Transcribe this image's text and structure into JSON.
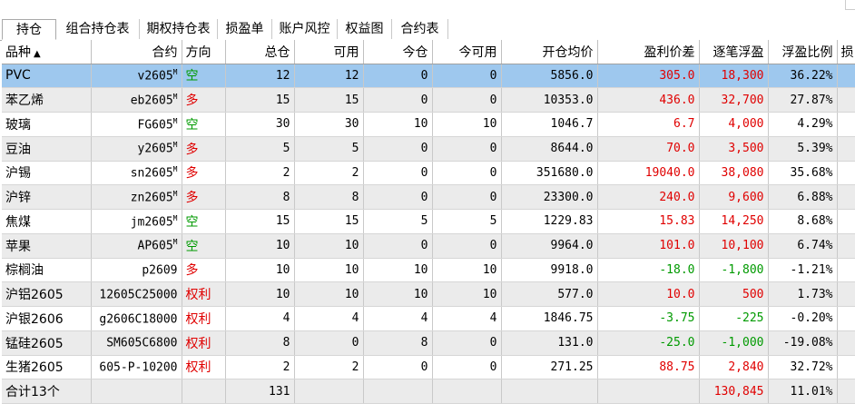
{
  "tabs": [
    "持仓",
    "组合持仓表",
    "期权持仓表",
    "损盈单",
    "账户风控",
    "权益图",
    "合约表"
  ],
  "active_tab": 0,
  "colors": {
    "selected_row": "#9ec8ee",
    "stripe": "#ebebeb",
    "up": "#e00000",
    "down": "#009a00"
  },
  "columns": [
    "品种",
    "合约",
    "方向",
    "总仓",
    "可用",
    "今仓",
    "今可用",
    "开仓均价",
    "盈利价差",
    "逐笔浮盈",
    "浮盈比例",
    "损..."
  ],
  "sort_indicator": "▲",
  "rows": [
    {
      "name": "PVC",
      "contract": "v2605",
      "sup": "M",
      "dir": "空",
      "dir_color": "green",
      "total": "12",
      "avail": "12",
      "today": "0",
      "today_avail": "0",
      "open_avg": "5856.0",
      "profit_spread": "305.0",
      "spread_color": "red",
      "float_pnl": "18,300",
      "pnl_color": "red",
      "ratio": "36.22%",
      "selected": true
    },
    {
      "name": "苯乙烯",
      "contract": "eb2605",
      "sup": "M",
      "dir": "多",
      "dir_color": "red",
      "total": "15",
      "avail": "15",
      "today": "0",
      "today_avail": "0",
      "open_avg": "10353.0",
      "profit_spread": "436.0",
      "spread_color": "red",
      "float_pnl": "32,700",
      "pnl_color": "red",
      "ratio": "27.87%"
    },
    {
      "name": "玻璃",
      "contract": "FG605",
      "sup": "M",
      "dir": "空",
      "dir_color": "green",
      "total": "30",
      "avail": "30",
      "today": "10",
      "today_avail": "10",
      "open_avg": "1046.7",
      "profit_spread": "6.7",
      "spread_color": "red",
      "float_pnl": "4,000",
      "pnl_color": "red",
      "ratio": "4.29%"
    },
    {
      "name": "豆油",
      "contract": "y2605",
      "sup": "M",
      "dir": "多",
      "dir_color": "red",
      "total": "5",
      "avail": "5",
      "today": "0",
      "today_avail": "0",
      "open_avg": "8644.0",
      "profit_spread": "70.0",
      "spread_color": "red",
      "float_pnl": "3,500",
      "pnl_color": "red",
      "ratio": "5.39%"
    },
    {
      "name": "沪锡",
      "contract": "sn2605",
      "sup": "M",
      "dir": "多",
      "dir_color": "red",
      "total": "2",
      "avail": "2",
      "today": "0",
      "today_avail": "0",
      "open_avg": "351680.0",
      "profit_spread": "19040.0",
      "spread_color": "red",
      "float_pnl": "38,080",
      "pnl_color": "red",
      "ratio": "35.68%"
    },
    {
      "name": "沪锌",
      "contract": "zn2605",
      "sup": "M",
      "dir": "多",
      "dir_color": "red",
      "total": "8",
      "avail": "8",
      "today": "0",
      "today_avail": "0",
      "open_avg": "23300.0",
      "profit_spread": "240.0",
      "spread_color": "red",
      "float_pnl": "9,600",
      "pnl_color": "red",
      "ratio": "6.88%"
    },
    {
      "name": "焦煤",
      "contract": "jm2605",
      "sup": "M",
      "dir": "空",
      "dir_color": "green",
      "total": "15",
      "avail": "15",
      "today": "5",
      "today_avail": "5",
      "open_avg": "1229.83",
      "profit_spread": "15.83",
      "spread_color": "red",
      "float_pnl": "14,250",
      "pnl_color": "red",
      "ratio": "8.68%"
    },
    {
      "name": "苹果",
      "contract": "AP605",
      "sup": "M",
      "dir": "空",
      "dir_color": "green",
      "total": "10",
      "avail": "10",
      "today": "0",
      "today_avail": "0",
      "open_avg": "9964.0",
      "profit_spread": "101.0",
      "spread_color": "red",
      "float_pnl": "10,100",
      "pnl_color": "red",
      "ratio": "6.74%"
    },
    {
      "name": "棕榈油",
      "contract": "p2609",
      "sup": "",
      "dir": "多",
      "dir_color": "red",
      "total": "10",
      "avail": "10",
      "today": "10",
      "today_avail": "10",
      "open_avg": "9918.0",
      "profit_spread": "-18.0",
      "spread_color": "green",
      "float_pnl": "-1,800",
      "pnl_color": "green",
      "ratio": "-1.21%"
    },
    {
      "name": "沪铝2605",
      "contract": "12605C25000",
      "sup": "",
      "dir": "权利",
      "dir_color": "red",
      "total": "10",
      "avail": "10",
      "today": "10",
      "today_avail": "10",
      "open_avg": "577.0",
      "profit_spread": "10.0",
      "spread_color": "red",
      "float_pnl": "500",
      "pnl_color": "red",
      "ratio": "1.73%"
    },
    {
      "name": "沪银2606",
      "contract": "g2606C18000",
      "sup": "",
      "dir": "权利",
      "dir_color": "red",
      "total": "4",
      "avail": "4",
      "today": "4",
      "today_avail": "4",
      "open_avg": "1846.75",
      "profit_spread": "-3.75",
      "spread_color": "green",
      "float_pnl": "-225",
      "pnl_color": "green",
      "ratio": "-0.20%"
    },
    {
      "name": "锰硅2605",
      "contract": "SM605C6800",
      "sup": "",
      "dir": "权利",
      "dir_color": "red",
      "total": "8",
      "avail": "0",
      "today": "8",
      "today_avail": "0",
      "open_avg": "131.0",
      "profit_spread": "-25.0",
      "spread_color": "green",
      "float_pnl": "-1,000",
      "pnl_color": "green",
      "ratio": "-19.08%"
    },
    {
      "name": "生猪2605",
      "contract": "605-P-10200",
      "sup": "",
      "dir": "权利",
      "dir_color": "red",
      "total": "2",
      "avail": "2",
      "today": "0",
      "today_avail": "0",
      "open_avg": "271.25",
      "profit_spread": "88.75",
      "spread_color": "red",
      "float_pnl": "2,840",
      "pnl_color": "red",
      "ratio": "32.72%"
    }
  ],
  "summary": {
    "label": "合计13个",
    "total": "131",
    "float_pnl": "130,845",
    "ratio": "11.01%"
  }
}
